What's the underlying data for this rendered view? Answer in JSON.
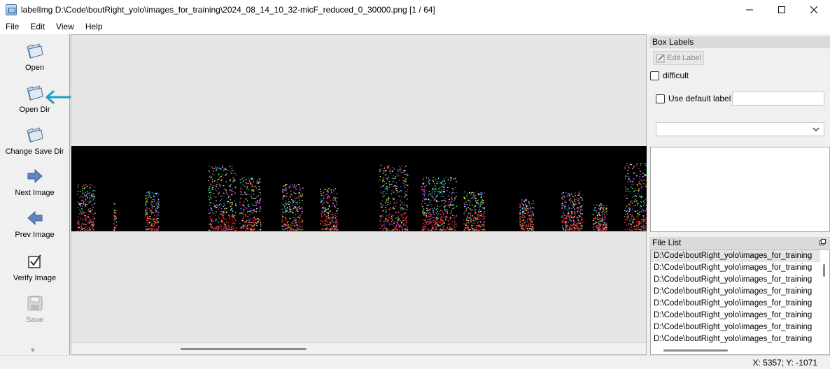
{
  "window": {
    "title": "labelImg D:\\Code\\boutRight_yolo\\images_for_training\\2024_08_14_10_32-micF_reduced_0_30000.png [1 / 64]",
    "controls": {
      "minimize": "—",
      "maximize": "☐",
      "close": "✕"
    }
  },
  "menu": [
    "File",
    "Edit",
    "View",
    "Help"
  ],
  "toolbar": {
    "items": [
      {
        "label": "Open",
        "icon": "folder-open-icon",
        "enabled": true
      },
      {
        "label": "Open Dir",
        "icon": "folder-open-icon",
        "enabled": true
      },
      {
        "label": "Change Save Dir",
        "icon": "folder-open-icon",
        "enabled": true
      },
      {
        "label": "Next Image",
        "icon": "arrow-right-icon",
        "enabled": true
      },
      {
        "label": "Prev Image",
        "icon": "arrow-left-icon",
        "enabled": true
      },
      {
        "label": "Verify Image",
        "icon": "checkbox-icon",
        "enabled": true
      },
      {
        "label": "Save",
        "icon": "save-disk-icon",
        "enabled": false
      }
    ],
    "more": "»"
  },
  "annotation": {
    "arrow_color": "#1aa0c8"
  },
  "box_labels": {
    "title": "Box Labels",
    "edit_label": "Edit Label",
    "difficult": "difficult",
    "use_default_label": "Use default label",
    "default_label_value": "",
    "combo_value": ""
  },
  "file_list": {
    "title": "File List",
    "items": [
      "D:\\Code\\boutRight_yolo\\images_for_training",
      "D:\\Code\\boutRight_yolo\\images_for_training",
      "D:\\Code\\boutRight_yolo\\images_for_training",
      "D:\\Code\\boutRight_yolo\\images_for_training",
      "D:\\Code\\boutRight_yolo\\images_for_training",
      "D:\\Code\\boutRight_yolo\\images_for_training",
      "D:\\Code\\boutRight_yolo\\images_for_training",
      "D:\\Code\\boutRight_yolo\\images_for_training"
    ]
  },
  "status": {
    "coords": "X: 5357; Y: -1071"
  }
}
